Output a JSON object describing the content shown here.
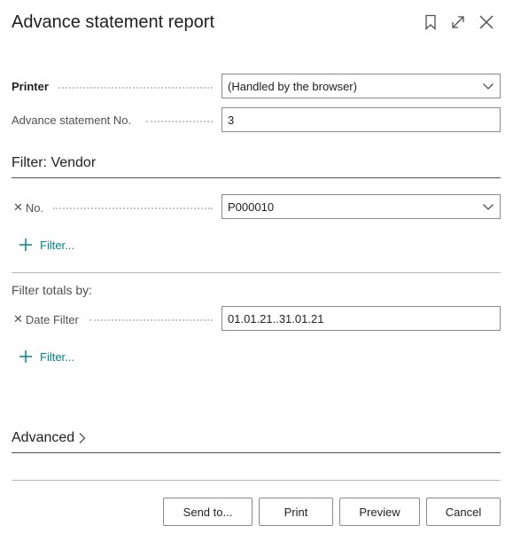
{
  "dialog": {
    "title": "Advance statement report"
  },
  "options": {
    "printer_label": "Printer",
    "printer_value": "(Handled by the browser)",
    "statement_no_label": "Advance statement No.",
    "statement_no_value": "3"
  },
  "vendor_filter": {
    "title": "Filter: Vendor",
    "no_label": "No.",
    "no_value": "P000010",
    "add_filter_label": "Filter..."
  },
  "totals_filter": {
    "title": "Filter totals by:",
    "date_label": "Date Filter",
    "date_value": "01.01.21..31.01.21",
    "add_filter_label": "Filter..."
  },
  "advanced": {
    "label": "Advanced"
  },
  "footer": {
    "send_to_label": "Send to...",
    "print_label": "Print",
    "preview_label": "Preview",
    "cancel_label": "Cancel"
  },
  "icons": {
    "bookmark": "bookmark-icon",
    "expand": "expand-icon",
    "close": "close-icon",
    "chevron": "chevron-down-icon",
    "remove": "remove-filter-icon",
    "plus": "plus-icon",
    "chevron_right": "chevron-right-icon"
  },
  "colors": {
    "accent": "#008489",
    "text": "#212121",
    "muted": "#505050"
  }
}
